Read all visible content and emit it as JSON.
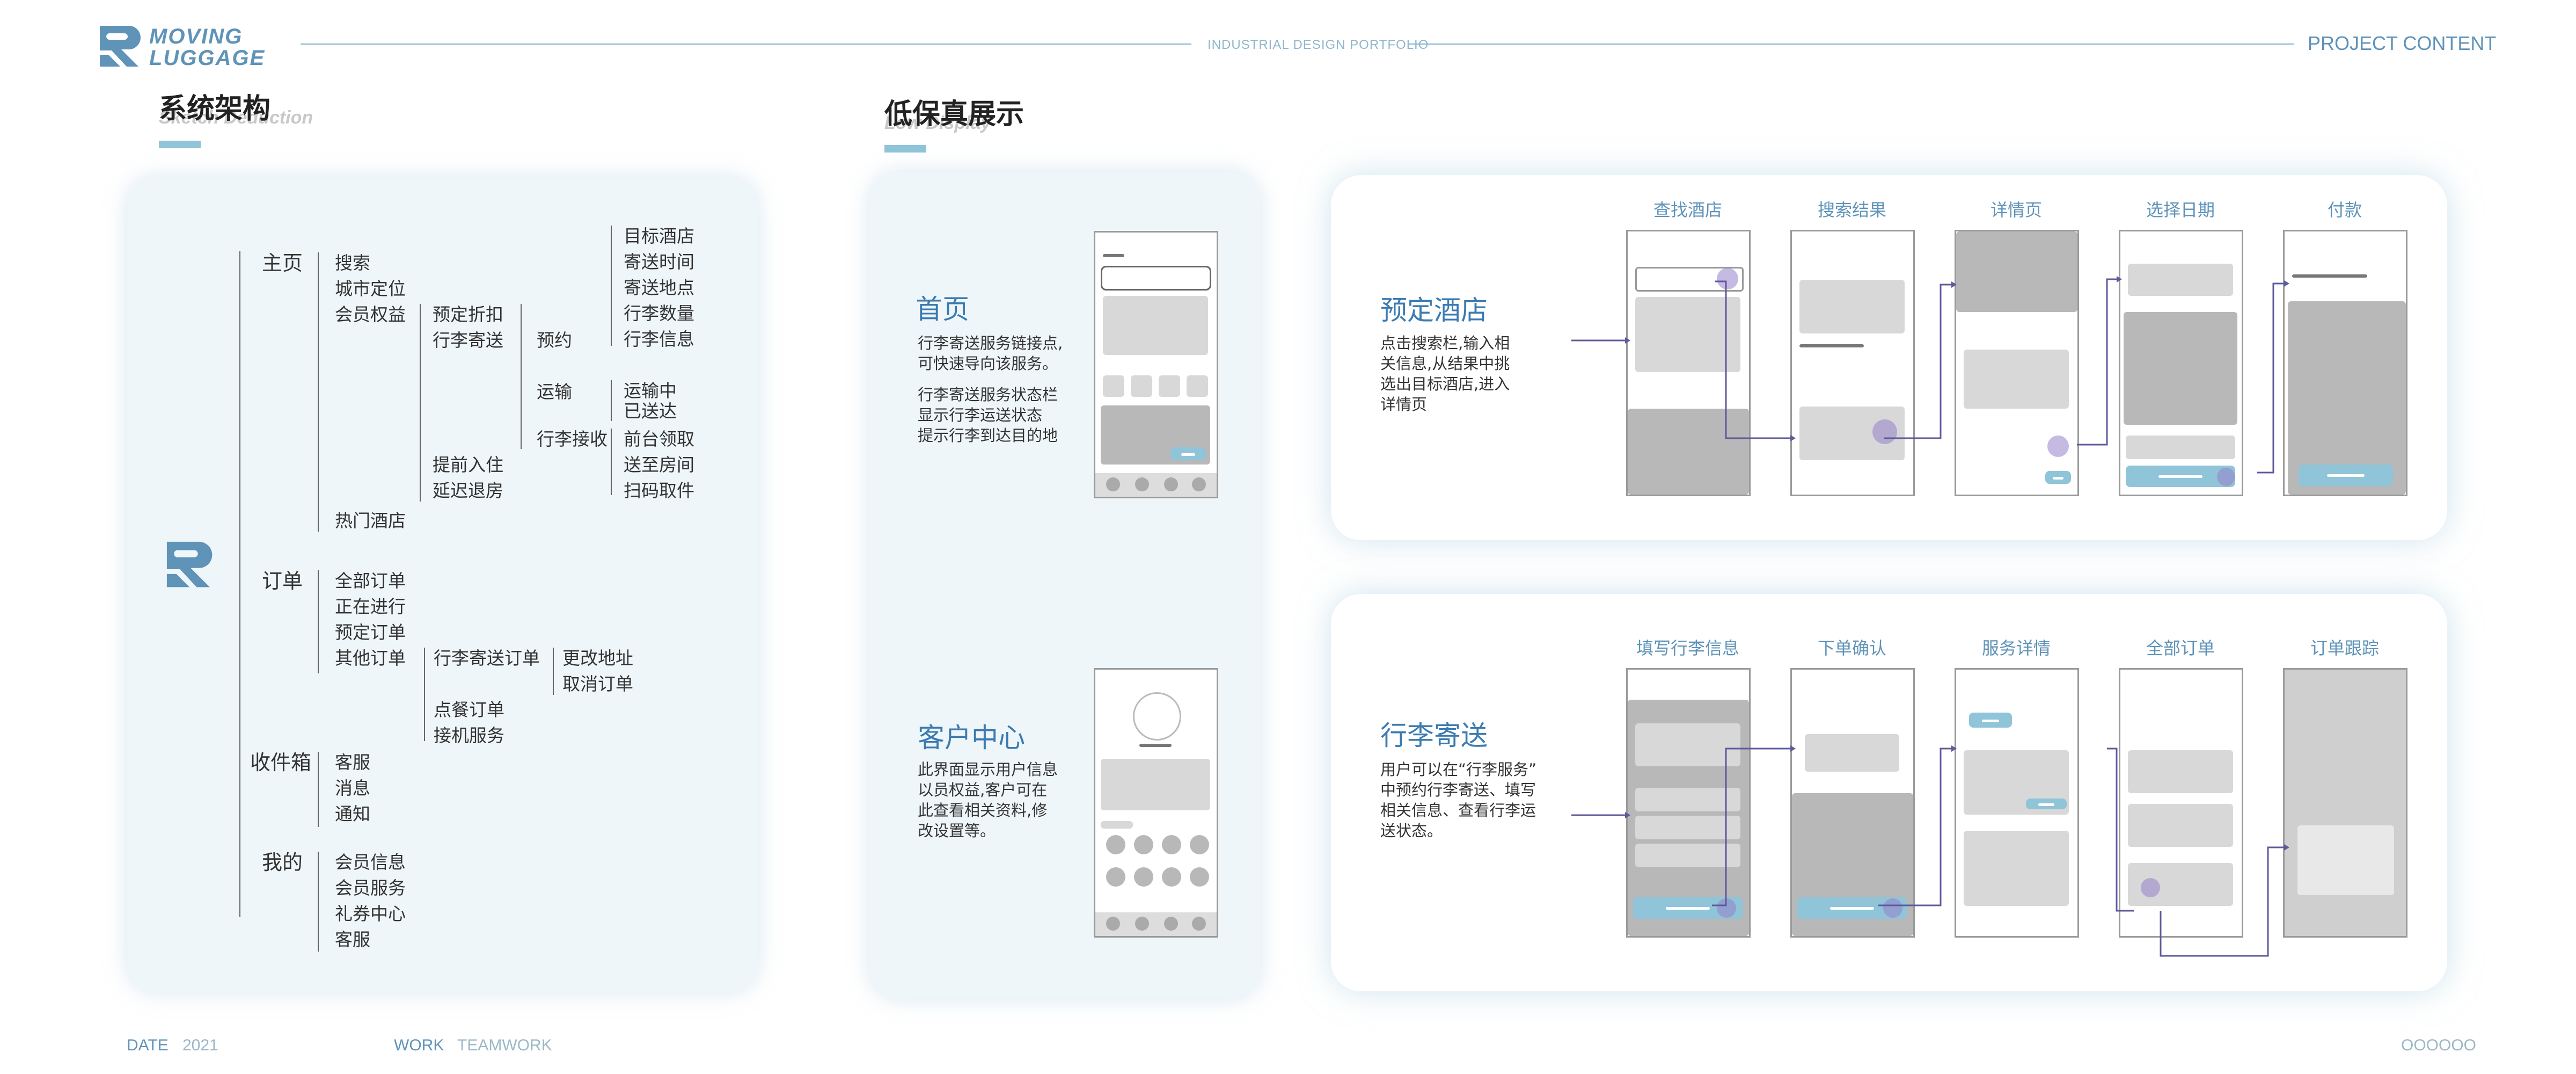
{
  "header": {
    "logo_line1": "MOVING",
    "logo_line2": "LUGGAGE",
    "center_label": "INDUSTRIAL DESIGN PORTFOLIO",
    "right_label": "PROJECT CONTENT"
  },
  "architecture": {
    "title": "系统架构",
    "subtitle": "Sketch Deduction",
    "home": {
      "label": "主页",
      "items": [
        "搜索",
        "城市定位",
        "会员权益",
        "热门酒店"
      ],
      "benefits": [
        "预定折扣",
        "行李寄送",
        "提前入住",
        "延迟退房"
      ],
      "booking": "预约",
      "booking_items": [
        "目标酒店",
        "寄送时间",
        "寄送地点",
        "行李数量",
        "行李信息"
      ],
      "transport": "运输",
      "transport_items": [
        "运输中",
        "已送达"
      ],
      "receive": "行李接收",
      "receive_items": [
        "前台领取",
        "送至房间",
        "扫码取件"
      ]
    },
    "orders": {
      "label": "订单",
      "items": [
        "全部订单",
        "正在进行",
        "预定订单",
        "其他订单"
      ],
      "other_items": [
        "行李寄送订单",
        "点餐订单",
        "接机服务"
      ],
      "luggage_order_items": [
        "更改地址",
        "取消订单"
      ]
    },
    "inbox": {
      "label": "收件箱",
      "items": [
        "客服",
        "消息",
        "通知"
      ]
    },
    "mine": {
      "label": "我的",
      "items": [
        "会员信息",
        "会员服务",
        "礼券中心",
        "客服"
      ]
    }
  },
  "lowfi": {
    "title": "低保真展示",
    "subtitle": "Low Display",
    "home": {
      "title": "首页",
      "desc1_line1": "行李寄送服务链接点,",
      "desc1_line2": "可快速导向该服务。",
      "desc2_line1": "行李寄送服务状态栏",
      "desc2_line2": "显示行李运送状态",
      "desc2_line3": "提示行李到达目的地"
    },
    "user_center": {
      "title": "客户中心",
      "desc_line1": "此界面显示用户信息",
      "desc_line2": "以员权益,客户可在",
      "desc_line3": "此查看相关资料,修",
      "desc_line4": "改设置等。"
    }
  },
  "hotel_flow": {
    "title": "预定酒店",
    "desc_line1": "点击搜索栏,输入相",
    "desc_line2": "关信息,从结果中挑",
    "desc_line3": "选出目标酒店,进入",
    "desc_line4": "详情页",
    "screens": [
      "查找酒店",
      "搜索结果",
      "详情页",
      "选择日期",
      "付款"
    ]
  },
  "luggage_flow": {
    "title": "行李寄送",
    "desc_line1": "用户可以在“行李服务”",
    "desc_line2": "中预约行李寄送、填写",
    "desc_line3": "相关信息、查看行李运",
    "desc_line4": "送状态。",
    "screens": [
      "填写行李信息",
      "下单确认",
      "服务详情",
      "全部订单",
      "订单跟踪"
    ]
  },
  "footer": {
    "date_label": "DATE",
    "date_value": "2021",
    "work_label": "WORK",
    "work_value": "TEAMWORK",
    "page_label": "OOOOOO"
  },
  "colors": {
    "accent": "#5f93b8",
    "light_blue": "#8fc4d9",
    "panel_bg": "#eef6f9",
    "highlight": "#9b8ccf"
  }
}
